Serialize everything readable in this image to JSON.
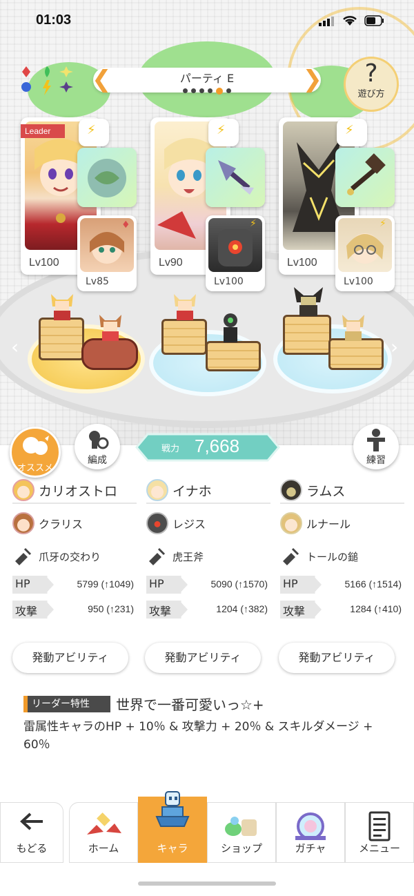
{
  "status": {
    "time": "01:03"
  },
  "party": {
    "title": "パーティ E",
    "page_count": 6,
    "current_page": 5
  },
  "help": {
    "symbol": "?",
    "label": "遊び方"
  },
  "cards": [
    {
      "leader_badge": "Leader",
      "main_level": "Lv100",
      "sub_level": "Lv85"
    },
    {
      "main_level": "Lv90",
      "sub_level": "Lv100"
    },
    {
      "main_level": "Lv100",
      "sub_level": "Lv100"
    }
  ],
  "buttons": {
    "recommend": "オススメ",
    "formation": "編成",
    "practice": "練習"
  },
  "power": {
    "label": "戦力",
    "value": "7,668"
  },
  "columns": [
    {
      "main": "カリオストロ",
      "sub": "クラリス",
      "weapon": "爪牙の交わり",
      "hp_label": "HP",
      "hp": "5799 (↑1049)",
      "atk_label": "攻撃",
      "atk": "950 (↑231)",
      "ability": "発動アビリティ"
    },
    {
      "main": "イナホ",
      "sub": "レジス",
      "weapon": "虎王斧",
      "hp_label": "HP",
      "hp": "5090 (↑1570)",
      "atk_label": "攻撃",
      "atk": "1204 (↑382)",
      "ability": "発動アビリティ"
    },
    {
      "main": "ラムス",
      "sub": "ルナール",
      "weapon": "トールの鎚",
      "hp_label": "HP",
      "hp": "5166 (↑1514)",
      "atk_label": "攻撃",
      "atk": "1284 (↑410)",
      "ability": "発動アビリティ"
    }
  ],
  "leader": {
    "tag": "リーダー特性",
    "title": "世界で一番可愛いっ☆+",
    "description": "雷属性キャラのHP + 10％ & 攻撃力 + 20％ & スキルダメージ + 60％"
  },
  "nav": [
    {
      "label": "もどる"
    },
    {
      "label": "ホーム"
    },
    {
      "label": "キャラ"
    },
    {
      "label": "ショップ"
    },
    {
      "label": "ガチャ"
    },
    {
      "label": "メニュー"
    }
  ],
  "colors": {
    "accent": "#f19a2a",
    "power": "#6ccfc0",
    "lightning": "#f3c21b",
    "active_tab": "#f4a63a"
  }
}
